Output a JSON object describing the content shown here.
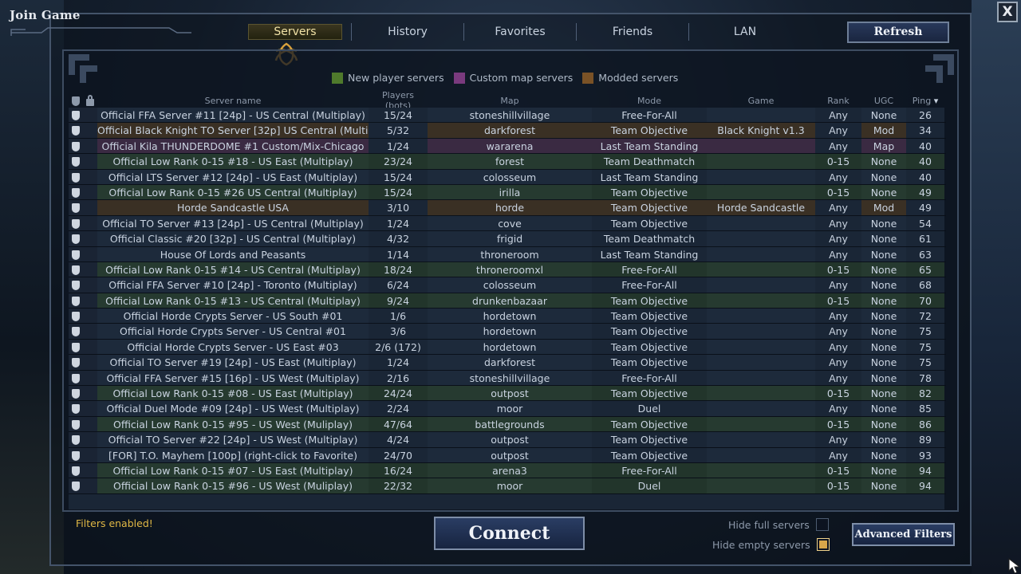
{
  "window": {
    "title": "Join Game",
    "close_label": "X"
  },
  "tabs": [
    {
      "label": "Servers",
      "active": true
    },
    {
      "label": "History",
      "active": false
    },
    {
      "label": "Favorites",
      "active": false
    },
    {
      "label": "Friends",
      "active": false
    },
    {
      "label": "LAN",
      "active": false
    }
  ],
  "refresh_label": "Refresh",
  "legend": [
    {
      "label": "New player servers",
      "color": "#4f7a2c"
    },
    {
      "label": "Custom map servers",
      "color": "#7a3a7e"
    },
    {
      "label": "Modded servers",
      "color": "#7a5226"
    }
  ],
  "columns": {
    "name": "Server name",
    "players": "Players (bots)",
    "map": "Map",
    "mode": "Mode",
    "game": "Game",
    "rank": "Rank",
    "ugc": "UGC",
    "ping": "Ping"
  },
  "sort_indicator": "▾",
  "servers": [
    {
      "name": "Official FFA Server #11 [24p] - US Central (Multiplay)",
      "players": "15/24",
      "map": "stoneshillvillage",
      "mode": "Free-For-All",
      "game": "",
      "rank": "Any",
      "ugc": "None",
      "ping": "26",
      "type": "normal"
    },
    {
      "name": "Official Black Knight TO Server [32p] US Central (Multip",
      "players": "5/32",
      "map": "darkforest",
      "mode": "Team Objective",
      "game": "Black Knight v1.3",
      "rank": "Any",
      "ugc": "Mod",
      "ping": "34",
      "type": "modded"
    },
    {
      "name": "Official Kila THUNDERDOME #1 Custom/Mix-Chicago",
      "players": "1/24",
      "map": "wararena",
      "mode": "Last Team Standing",
      "game": "",
      "rank": "Any",
      "ugc": "Map",
      "ping": "40",
      "type": "custom"
    },
    {
      "name": "Official Low Rank 0-15 #18 - US East (Multiplay)",
      "players": "23/24",
      "map": "forest",
      "mode": "Team Deathmatch",
      "game": "",
      "rank": "0-15",
      "ugc": "None",
      "ping": "40",
      "type": "newp"
    },
    {
      "name": "Official LTS Server #12 [24p] - US East (Multiplay)",
      "players": "15/24",
      "map": "colosseum",
      "mode": "Last Team Standing",
      "game": "",
      "rank": "Any",
      "ugc": "None",
      "ping": "40",
      "type": "normal"
    },
    {
      "name": "Official Low Rank 0-15 #26 US Central (Multiplay)",
      "players": "15/24",
      "map": "irilla",
      "mode": "Team Objective",
      "game": "",
      "rank": "0-15",
      "ugc": "None",
      "ping": "49",
      "type": "newp"
    },
    {
      "name": "Horde Sandcastle USA",
      "players": "3/10",
      "map": "horde",
      "mode": "Team Objective",
      "game": "Horde Sandcastle",
      "rank": "Any",
      "ugc": "Mod",
      "ping": "49",
      "type": "modded"
    },
    {
      "name": "Official TO Server #13 [24p] - US Central (Multiplay)",
      "players": "1/24",
      "map": "cove",
      "mode": "Team Objective",
      "game": "",
      "rank": "Any",
      "ugc": "None",
      "ping": "54",
      "type": "normal"
    },
    {
      "name": "Official Classic #20 [32p] - US Central (Multiplay)",
      "players": "4/32",
      "map": "frigid",
      "mode": "Team Deathmatch",
      "game": "",
      "rank": "Any",
      "ugc": "None",
      "ping": "61",
      "type": "normal"
    },
    {
      "name": "House Of Lords and Peasants",
      "players": "1/14",
      "map": "throneroom",
      "mode": "Last Team Standing",
      "game": "",
      "rank": "Any",
      "ugc": "None",
      "ping": "63",
      "type": "normal"
    },
    {
      "name": "Official Low Rank 0-15 #14 - US Central (Multiplay)",
      "players": "18/24",
      "map": "throneroomxl",
      "mode": "Free-For-All",
      "game": "",
      "rank": "0-15",
      "ugc": "None",
      "ping": "65",
      "type": "newp"
    },
    {
      "name": "Official FFA Server #10 [24p] - Toronto (Multiplay)",
      "players": "6/24",
      "map": "colosseum",
      "mode": "Free-For-All",
      "game": "",
      "rank": "Any",
      "ugc": "None",
      "ping": "68",
      "type": "normal"
    },
    {
      "name": "Official Low Rank 0-15 #13 - US Central (Multiplay)",
      "players": "9/24",
      "map": "drunkenbazaar",
      "mode": "Team Objective",
      "game": "",
      "rank": "0-15",
      "ugc": "None",
      "ping": "70",
      "type": "newp"
    },
    {
      "name": "Official Horde Crypts Server - US South #01",
      "players": "1/6",
      "map": "hordetown",
      "mode": "Team Objective",
      "game": "",
      "rank": "Any",
      "ugc": "None",
      "ping": "72",
      "type": "normal"
    },
    {
      "name": "Official Horde Crypts Server - US Central #01",
      "players": "3/6",
      "map": "hordetown",
      "mode": "Team Objective",
      "game": "",
      "rank": "Any",
      "ugc": "None",
      "ping": "75",
      "type": "normal"
    },
    {
      "name": "Official Horde Crypts Server - US East #03",
      "players": "2/6 (172)",
      "map": "hordetown",
      "mode": "Team Objective",
      "game": "",
      "rank": "Any",
      "ugc": "None",
      "ping": "75",
      "type": "normal"
    },
    {
      "name": "Official TO Server #19 [24p] - US East (Multiplay)",
      "players": "1/24",
      "map": "darkforest",
      "mode": "Team Objective",
      "game": "",
      "rank": "Any",
      "ugc": "None",
      "ping": "75",
      "type": "normal"
    },
    {
      "name": "Official FFA Server #15 [16p] - US West (Multiplay)",
      "players": "2/16",
      "map": "stoneshillvillage",
      "mode": "Free-For-All",
      "game": "",
      "rank": "Any",
      "ugc": "None",
      "ping": "78",
      "type": "normal"
    },
    {
      "name": "Official Low Rank 0-15 #08 - US East (Multiplay)",
      "players": "24/24",
      "map": "outpost",
      "mode": "Team Objective",
      "game": "",
      "rank": "0-15",
      "ugc": "None",
      "ping": "82",
      "type": "newp"
    },
    {
      "name": "Official Duel Mode #09 [24p] - US West (Multiplay)",
      "players": "2/24",
      "map": "moor",
      "mode": "Duel",
      "game": "",
      "rank": "Any",
      "ugc": "None",
      "ping": "85",
      "type": "normal"
    },
    {
      "name": "Official Low Rank 0-15 #95 - US West (Muliplay)",
      "players": "47/64",
      "map": "battlegrounds",
      "mode": "Team Objective",
      "game": "",
      "rank": "0-15",
      "ugc": "None",
      "ping": "86",
      "type": "newp"
    },
    {
      "name": "Official TO Server #22 [24p] - US West (Multiplay)",
      "players": "4/24",
      "map": "outpost",
      "mode": "Team Objective",
      "game": "",
      "rank": "Any",
      "ugc": "None",
      "ping": "89",
      "type": "normal"
    },
    {
      "name": "[FOR] T.O. Mayhem [100p] (right-click to Favorite)",
      "players": "24/70",
      "map": "outpost",
      "mode": "Team Objective",
      "game": "",
      "rank": "Any",
      "ugc": "None",
      "ping": "93",
      "type": "normal"
    },
    {
      "name": "Official Low Rank 0-15 #07 - US East (Multiplay)",
      "players": "16/24",
      "map": "arena3",
      "mode": "Free-For-All",
      "game": "",
      "rank": "0-15",
      "ugc": "None",
      "ping": "94",
      "type": "newp"
    },
    {
      "name": "Official Low Rank 0-15 #96 - US West (Muliplay)",
      "players": "22/32",
      "map": "moor",
      "mode": "Duel",
      "game": "",
      "rank": "0-15",
      "ugc": "None",
      "ping": "94",
      "type": "newp"
    }
  ],
  "footer": {
    "filters_text": "Filters enabled!",
    "connect_label": "Connect",
    "hide_full_label": "Hide full servers",
    "hide_full_checked": false,
    "hide_empty_label": "Hide empty servers",
    "hide_empty_checked": true,
    "advanced_label": "Advanced Filters"
  }
}
